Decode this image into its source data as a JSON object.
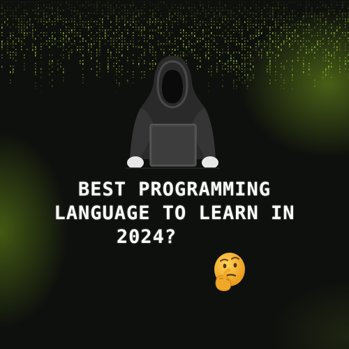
{
  "headline": {
    "line1": "BEST PROGRAMMING",
    "line2": "LANGUAGE TO LEARN IN",
    "line3": "2024?"
  },
  "icons": {
    "hooded_figure": "hooded-hacker-with-laptop",
    "emoji": "thinking-face-emoji"
  },
  "colors": {
    "background": "#0e100d",
    "matrix_green": "#9bc53d",
    "glow": "#78a01e",
    "text": "#ffffff",
    "emoji": "#f5b52c"
  }
}
